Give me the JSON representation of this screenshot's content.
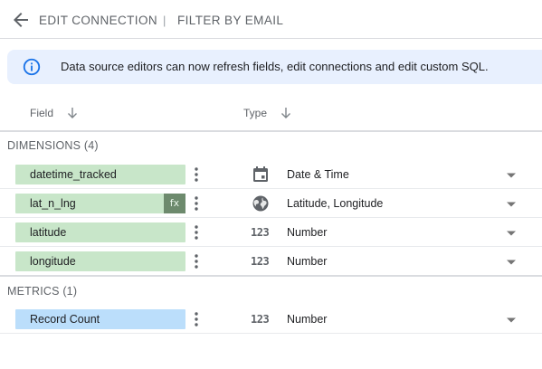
{
  "header": {
    "back_icon": "arrow-back-icon",
    "title": "EDIT CONNECTION",
    "separator": "|",
    "subtitle": "FILTER BY EMAIL"
  },
  "banner": {
    "icon": "info-icon",
    "message": "Data source editors can now refresh fields, edit connections and edit custom SQL."
  },
  "columns": {
    "field": "Field",
    "type": "Type"
  },
  "dimensions": {
    "label": "DIMENSIONS (4)",
    "rows": [
      {
        "name": "datetime_tracked",
        "type": "Date & Time",
        "type_icon": "calendar-icon",
        "calculated": false
      },
      {
        "name": "lat_n_lng",
        "type": "Latitude, Longitude",
        "type_icon": "globe-icon",
        "calculated": true,
        "calc_label": "fx"
      },
      {
        "name": "latitude",
        "type": "Number",
        "type_icon": "number-icon",
        "type_glyph": "123",
        "calculated": false
      },
      {
        "name": "longitude",
        "type": "Number",
        "type_icon": "number-icon",
        "type_glyph": "123",
        "calculated": false
      }
    ]
  },
  "metrics": {
    "label": "METRICS (1)",
    "rows": [
      {
        "name": "Record Count",
        "type": "Number",
        "type_icon": "number-icon",
        "type_glyph": "123"
      }
    ]
  },
  "colors": {
    "dimension_chip": "#c8e6c9",
    "metric_chip": "#bbdefb",
    "banner_bg": "#e8f0fe",
    "info_blue": "#1a73e8"
  }
}
